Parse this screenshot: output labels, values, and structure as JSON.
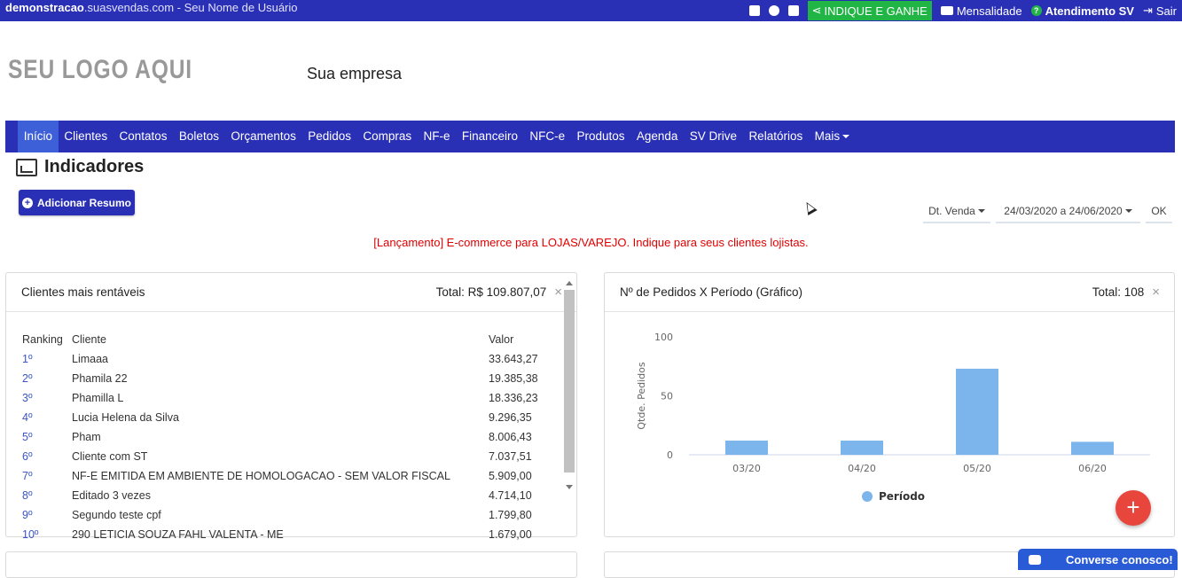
{
  "topbar": {
    "domain_bold": "demonstracao",
    "domain_rest": ".suasvendas.com",
    "user": " - Seu Nome de Usuário",
    "refer": "INDIQUE E GANHE",
    "billing": "Mensalidade",
    "support": "Atendimento SV",
    "logout": "Sair"
  },
  "header": {
    "logo": "SEU LOGO AQUI",
    "company": "Sua empresa"
  },
  "nav": [
    "Início",
    "Clientes",
    "Contatos",
    "Boletos",
    "Orçamentos",
    "Pedidos",
    "Compras",
    "NF-e",
    "Financeiro",
    "NFC-e",
    "Produtos",
    "Agenda",
    "SV Drive",
    "Relatórios",
    "Mais"
  ],
  "page": {
    "title": "Indicadores",
    "add_button": "Adicionar Resumo",
    "filter_type": "Dt. Venda",
    "filter_range": "24/03/2020 a 24/06/2020",
    "ok": "OK",
    "notice": "[Lançamento] E-commerce para LOJAS/VAREJO. Indique para seus clientes lojistas."
  },
  "card_clients": {
    "title": "Clientes mais rentáveis",
    "total": "Total: R$ 109.807,07",
    "close": "×",
    "headers": [
      "Ranking",
      "Cliente",
      "Valor"
    ],
    "rows": [
      {
        "rank": "1º",
        "name": "Limaaa",
        "value": "33.643,27"
      },
      {
        "rank": "2º",
        "name": "Phamila 22",
        "value": "19.385,38"
      },
      {
        "rank": "3º",
        "name": "Phamilla L",
        "value": "18.336,23"
      },
      {
        "rank": "4º",
        "name": "Lucia Helena da Silva",
        "value": "9.296,35"
      },
      {
        "rank": "5º",
        "name": "Pham",
        "value": "8.006,43"
      },
      {
        "rank": "6º",
        "name": "Cliente com ST",
        "value": "7.037,51"
      },
      {
        "rank": "7º",
        "name": "NF-E EMITIDA EM AMBIENTE DE HOMOLOGACAO - SEM VALOR FISCAL",
        "value": "5.909,00"
      },
      {
        "rank": "8º",
        "name": "Editado 3 vezes",
        "value": "4.714,10"
      },
      {
        "rank": "9º",
        "name": "Segundo teste cpf",
        "value": "1.799,80"
      },
      {
        "rank": "10º",
        "name": "290 LETICIA SOUZA FAHL VALENTA - ME",
        "value": "1.679,00"
      }
    ]
  },
  "card_orders": {
    "title": "Nº de Pedidos X Período (Gráfico)",
    "total": "Total: 108",
    "close": "×"
  },
  "chart_data": {
    "type": "bar",
    "categories": [
      "03/20",
      "04/20",
      "05/20",
      "06/20"
    ],
    "series": [
      {
        "name": "Período",
        "values": [
          12,
          12,
          73,
          11
        ],
        "color": "#7cb5ec"
      }
    ],
    "ylabel": "Qtde. Pedidos",
    "ylim": [
      0,
      100
    ],
    "yticks": [
      0,
      50,
      100
    ],
    "legend": "bottom-center"
  },
  "widgets": {
    "fab": "+",
    "chat": "Converse conosco!"
  }
}
